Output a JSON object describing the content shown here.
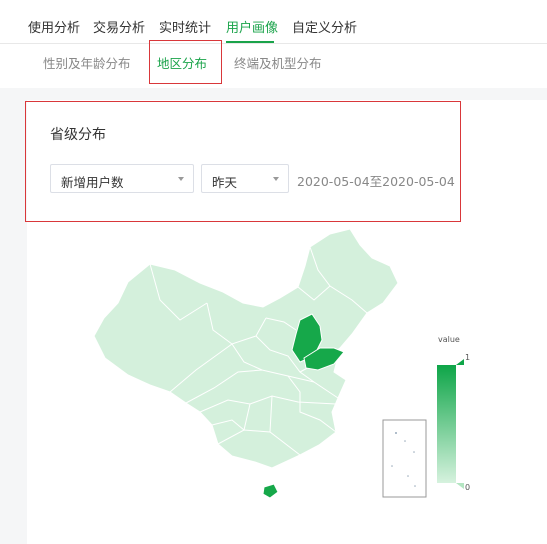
{
  "topnav": {
    "tabs": [
      {
        "label": "使用分析"
      },
      {
        "label": "交易分析"
      },
      {
        "label": "实时统计"
      },
      {
        "label": "用户画像"
      },
      {
        "label": "自定义分析"
      }
    ],
    "active_tab": "用户画像"
  },
  "subnav": {
    "tabs": [
      {
        "label": "性别及年龄分布"
      },
      {
        "label": "地区分布"
      },
      {
        "label": "终端及机型分布"
      }
    ],
    "active_tab": "地区分布"
  },
  "panel": {
    "title": "省级分布",
    "metric_select": "新增用户数",
    "period_select": "昨天",
    "date_range": "2020-05-04至2020-05-04"
  },
  "map_legend": {
    "name": "value",
    "max": "1",
    "min": "0",
    "color_high": "#0ea548",
    "color_low": "#d6f2de"
  },
  "colors": {
    "accent": "#1aa34a",
    "highlight_border": "#d9373a",
    "map_base": "#d4f0dc",
    "map_highlight": "#16a84a"
  }
}
